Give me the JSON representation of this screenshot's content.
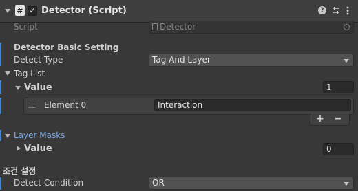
{
  "header": {
    "title": "Detector (Script)",
    "enabled": true,
    "icons": [
      "script-icon",
      "help-icon",
      "presets-icon",
      "kebab-menu-icon"
    ]
  },
  "script_row": {
    "label": "Script",
    "value": "Detector"
  },
  "basic_setting": {
    "heading": "Detector Basic Setting",
    "detect_type_label": "Detect Type",
    "detect_type_value": "Tag And Layer"
  },
  "tag_list": {
    "label": "Tag List",
    "value_label": "Value",
    "size": "1",
    "elements": [
      {
        "label": "Element 0",
        "value": "Interaction"
      }
    ],
    "add_label": "+",
    "remove_label": "−"
  },
  "layer_masks": {
    "label": "Layer Masks",
    "value_label": "Value",
    "size": "0"
  },
  "condition": {
    "heading": "조건 설정",
    "detect_condition_label": "Detect Condition",
    "detect_condition_value": "OR"
  },
  "colors": {
    "accent_blue": "#3d87d8",
    "link_blue": "#7aa9e6",
    "background": "#383838"
  }
}
